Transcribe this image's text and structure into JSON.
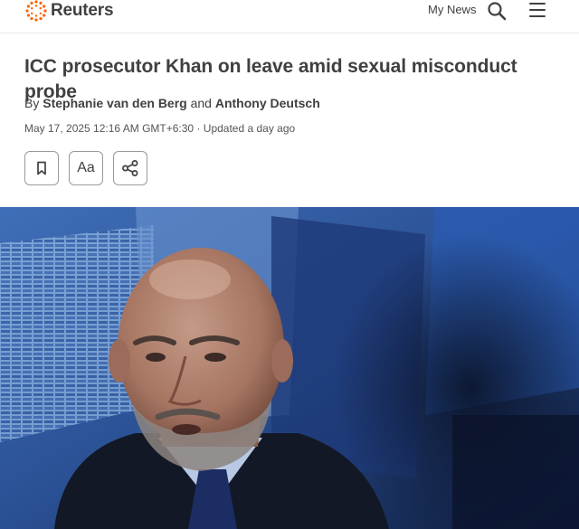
{
  "header": {
    "brand": "Reuters",
    "my_news_label": "My News",
    "search_icon": "search-icon",
    "menu_icon": "hamburger-menu-icon"
  },
  "article": {
    "headline": "ICC prosecutor Khan on leave amid sexual misconduct probe",
    "byline": {
      "prefix": "By",
      "author_1": "Stephanie van den Berg",
      "joiner": "and",
      "author_2": "Anthony Deutsch"
    },
    "dateline": "May 17, 2025 12:16 AM GMT+6:30 · Updated a day ago"
  },
  "toolbar": {
    "bookmark_icon": "bookmark-icon",
    "text_size_label": "Aa",
    "share_icon": "share-icon"
  },
  "colors": {
    "brand_orange": "#fa6400",
    "text": "#404040"
  }
}
